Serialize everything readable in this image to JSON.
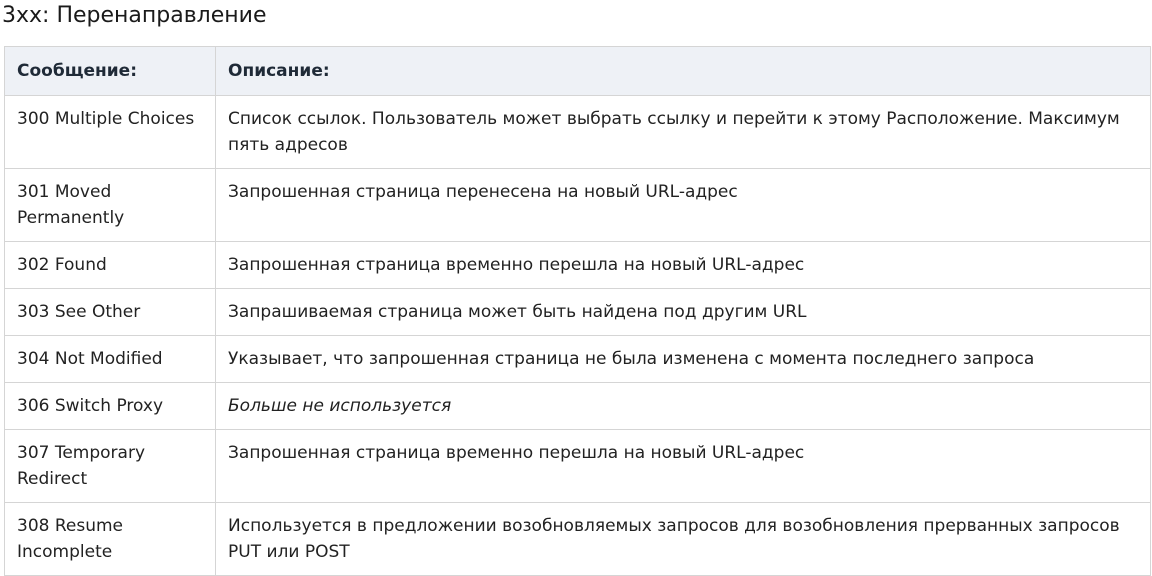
{
  "section": {
    "title": "3xx: Перенаправление"
  },
  "table": {
    "headers": {
      "message": "Сообщение:",
      "description": "Описание:"
    },
    "rows": [
      {
        "code": "300 Multiple Choices",
        "description": "Список ссылок. Пользователь может выбрать ссылку и перейти к этому Расположение. Максимум пять адресов"
      },
      {
        "code": "301 Moved Permanently",
        "description": "Запрошенная страница перенесена на новый URL-адрес"
      },
      {
        "code": "302 Found",
        "description": "Запрошенная страница временно перешла на новый URL-адрес"
      },
      {
        "code": "303 See Other",
        "description": "Запрашиваемая страница может быть найдена под другим URL"
      },
      {
        "code": "304 Not Modified",
        "description": "Указывает, что запрошенная страница не была изменена с момента последнего запроса"
      },
      {
        "code": "306 Switch Proxy",
        "description": "Больше не используется"
      },
      {
        "code": "307 Temporary Redirect",
        "description": "Запрошенная страница временно перешла на новый URL-адрес"
      },
      {
        "code": "308 Resume Incomplete",
        "description": "Используется в предложении возобновляемых запросов для возобновления прерванных запросов PUT или POST"
      }
    ]
  }
}
